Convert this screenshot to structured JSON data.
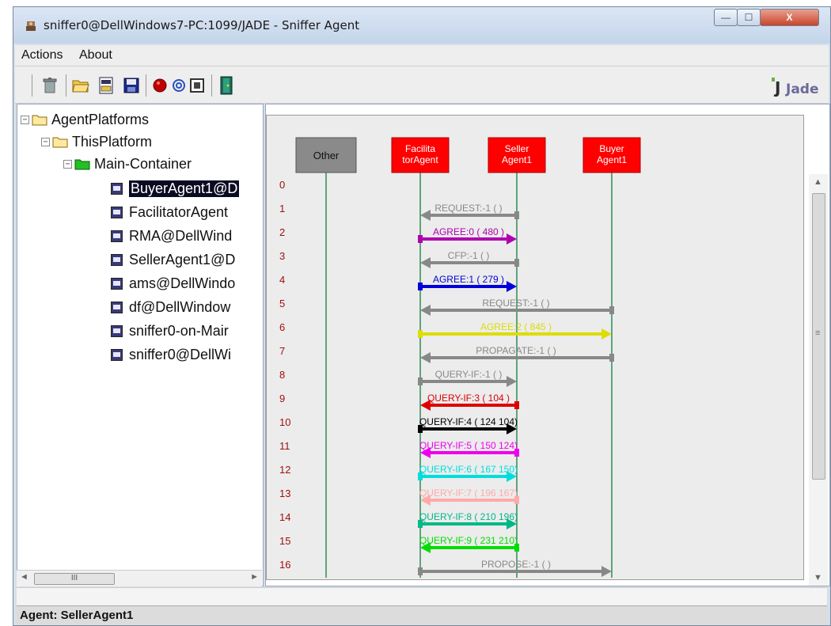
{
  "window": {
    "title": "sniffer0@DellWindows7-PC:1099/JADE - Sniffer Agent",
    "controls": {
      "minimize": "—",
      "maximize": "☐",
      "close": "X"
    }
  },
  "menu": {
    "items": [
      "Actions",
      "About"
    ]
  },
  "toolbar": {
    "icons": [
      "trash-icon",
      "open-folder-icon",
      "open-file-icon",
      "save-icon",
      "record-icon",
      "swirl-icon",
      "monitor-icon",
      "exit-door-icon"
    ],
    "logo_text": "Jade"
  },
  "tree": {
    "root": "AgentPlatforms",
    "platform": "ThisPlatform",
    "container": "Main-Container",
    "agents": [
      "BuyerAgent1@D",
      "FacilitatorAgent",
      "RMA@DellWind",
      "SellerAgent1@D",
      "ams@DellWindo",
      "df@DellWindow",
      "sniffer0-on-Mair",
      "sniffer0@DellWi"
    ],
    "selected_index": 0,
    "hscroll_label": "III"
  },
  "diagram": {
    "lanes": [
      {
        "label": "Other",
        "color": "#8a8a8a",
        "text_color": "#111111"
      },
      {
        "label": "Facilita torAgent",
        "color": "#ff0000",
        "text_color": "#ffffff"
      },
      {
        "label": "Seller Agent1",
        "color": "#ff0000",
        "text_color": "#ffffff"
      },
      {
        "label": "Buyer Agent1",
        "color": "#ff0000",
        "text_color": "#ffffff"
      }
    ],
    "row_numbers": [
      "0",
      "1",
      "2",
      "3",
      "4",
      "5",
      "6",
      "7",
      "8",
      "9",
      "10",
      "11",
      "12",
      "13",
      "14",
      "15",
      "16"
    ],
    "messages": [
      {
        "row": 1,
        "from": 2,
        "to": 1,
        "label": "REQUEST:-1 (        )",
        "color": "#888888"
      },
      {
        "row": 2,
        "from": 1,
        "to": 2,
        "label": "AGREE:0 (  480      )",
        "color": "#b000b0"
      },
      {
        "row": 3,
        "from": 2,
        "to": 1,
        "label": "CFP:-1 (        )",
        "color": "#888888"
      },
      {
        "row": 4,
        "from": 1,
        "to": 2,
        "label": "AGREE:1 (  279      )",
        "color": "#0000dd"
      },
      {
        "row": 5,
        "from": 3,
        "to": 1,
        "label": "REQUEST:-1 (        )",
        "color": "#888888"
      },
      {
        "row": 6,
        "from": 1,
        "to": 3,
        "label": "AGREE:2 (  845      )",
        "color": "#dddd00"
      },
      {
        "row": 7,
        "from": 3,
        "to": 1,
        "label": "PROPAGATE:-1 (        )",
        "color": "#888888"
      },
      {
        "row": 8,
        "from": 1,
        "to": 2,
        "label": "QUERY-IF:-1 (        )",
        "color": "#888888"
      },
      {
        "row": 9,
        "from": 2,
        "to": 1,
        "label": "QUERY-IF:3 (  104   )",
        "color": "#dd0000"
      },
      {
        "row": 10,
        "from": 1,
        "to": 2,
        "label": "QUERY-IF:4 (  124  104)",
        "color": "#000000"
      },
      {
        "row": 11,
        "from": 2,
        "to": 1,
        "label": "QUERY-IF:5 (  150  124)",
        "color": "#ee00ee"
      },
      {
        "row": 12,
        "from": 1,
        "to": 2,
        "label": "QUERY-IF:6 (  167  150)",
        "color": "#00dddd"
      },
      {
        "row": 13,
        "from": 2,
        "to": 1,
        "label": "QUERY-IF:7 (  196  167)",
        "color": "#ffaaaa"
      },
      {
        "row": 14,
        "from": 1,
        "to": 2,
        "label": "QUERY-IF:8 (  210  196)",
        "color": "#00b888"
      },
      {
        "row": 15,
        "from": 2,
        "to": 1,
        "label": "QUERY-IF:9 (  231  210)",
        "color": "#00dd00"
      },
      {
        "row": 16,
        "from": 1,
        "to": 3,
        "label": "PROPOSE:-1 (        )",
        "color": "#888888"
      }
    ]
  },
  "status": {
    "text": "Agent: SellerAgent1"
  },
  "colors": {
    "lifeline": "#2e8b57",
    "selection": "#0a0a22",
    "agent_box": "#ff0000",
    "other_box": "#8a8a8a"
  }
}
